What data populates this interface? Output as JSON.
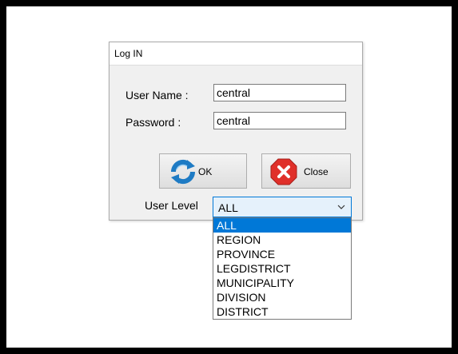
{
  "dialog": {
    "title": "Log IN",
    "username_label": "User Name :",
    "username_value": "central",
    "password_label": "Password :",
    "password_value": "central",
    "ok_label": "OK",
    "close_label": "Close",
    "user_level_label": "User Level",
    "user_level_selected": "ALL",
    "user_level_options": [
      "ALL",
      "REGION",
      "PROVINCE",
      "LEGDISTRICT",
      "MUNICIPALITY",
      "DIVISION",
      "DISTRICT"
    ]
  },
  "colors": {
    "frame": "#000000",
    "selection": "#0078d7",
    "combo_background": "#e5f1fb",
    "ok_icon": "#1e7bc4",
    "close_icon": "#e0302a"
  },
  "icons": {
    "ok": "refresh-arrows-icon",
    "close": "red-x-icon",
    "dropdown": "chevron-down-icon"
  }
}
